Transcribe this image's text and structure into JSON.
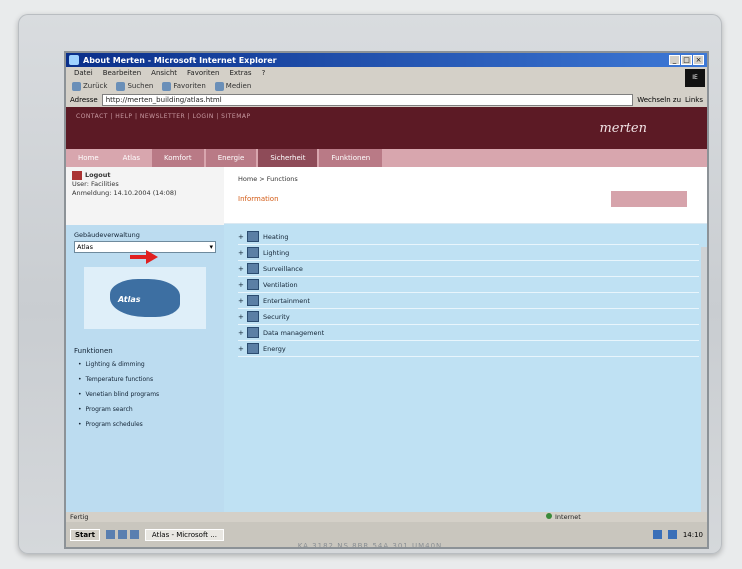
{
  "window": {
    "title": "About Merten - Microsoft Internet Explorer",
    "buttons": [
      "_",
      "□",
      "×"
    ],
    "throbber": "IE"
  },
  "menubar": {
    "items": [
      "Datei",
      "Bearbeiten",
      "Ansicht",
      "Favoriten",
      "Extras",
      "?"
    ]
  },
  "toolbar": {
    "items": [
      "Zurück",
      "Suchen",
      "Favoriten",
      "Medien"
    ]
  },
  "addressbar": {
    "label": "Adresse",
    "url": "http://merten_building/atlas.html",
    "go": "Wechseln zu",
    "links": "Links"
  },
  "site": {
    "topnav": "CONTACT | HELP | NEWSLETTER | LOGIN | SITEMAP",
    "brand": "merten",
    "nav": [
      "Home",
      "Atlas",
      "Komfort",
      "Energie",
      "Sicherheit",
      "Funktionen"
    ],
    "user": {
      "logout": "Logout",
      "name": "User: Facilities",
      "since": "Anmeldung: 14.10.2004 (14:08)"
    },
    "side_select_label": "Gebäudeverwaltung",
    "side_select_value": "Atlas",
    "logo_text": "Atlas",
    "links_head": "Funktionen",
    "links": [
      "Lighting & dimming",
      "Temperature functions",
      "Venetian blind programs",
      "Program search",
      "Program schedules"
    ],
    "breadcrumb": "Home > Functions",
    "alert": "Information",
    "functions": [
      "Heating",
      "Lighting",
      "Surveillance",
      "Ventilation",
      "Entertainment",
      "Security",
      "Data management",
      "Energy"
    ]
  },
  "statusbar": {
    "text": "Fertig",
    "zone": "Internet"
  },
  "taskbar": {
    "start": "Start",
    "task": "Atlas - Microsoft ...",
    "clock": "14:10"
  },
  "monitor_label": "KA 3182 NS 8BR 54A 301 UM40N"
}
